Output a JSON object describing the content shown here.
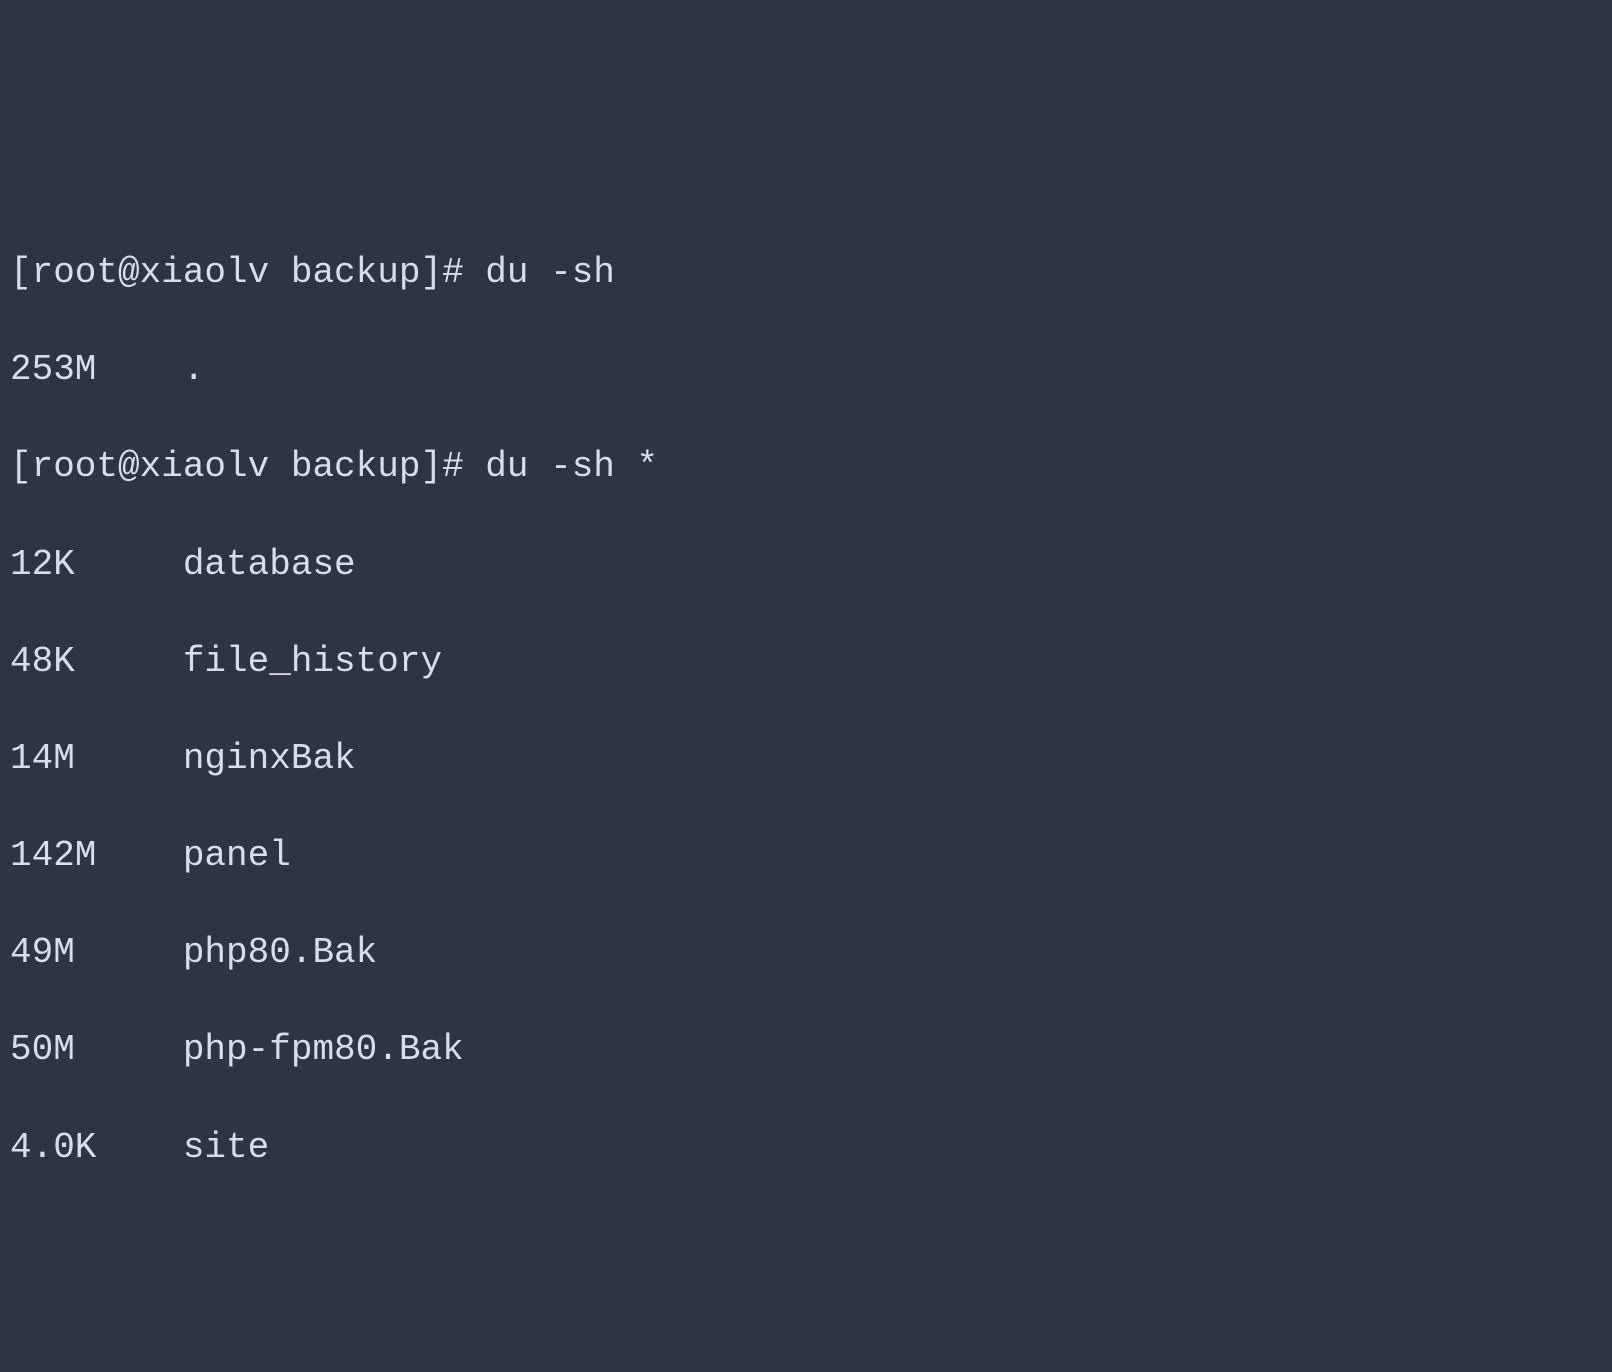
{
  "terminal": {
    "prompt": "[root@xiaolv backup]# ",
    "command1": "du -sh",
    "output1": {
      "size": "253M",
      "name": "."
    },
    "command2": "du -sh *",
    "output2": [
      {
        "size": "12K",
        "name": "database"
      },
      {
        "size": "48K",
        "name": "file_history"
      },
      {
        "size": "14M",
        "name": "nginxBak"
      },
      {
        "size": "142M",
        "name": "panel"
      },
      {
        "size": "49M",
        "name": "php80.Bak"
      },
      {
        "size": "50M",
        "name": "php-fpm80.Bak"
      },
      {
        "size": "4.0K",
        "name": "site"
      }
    ]
  }
}
